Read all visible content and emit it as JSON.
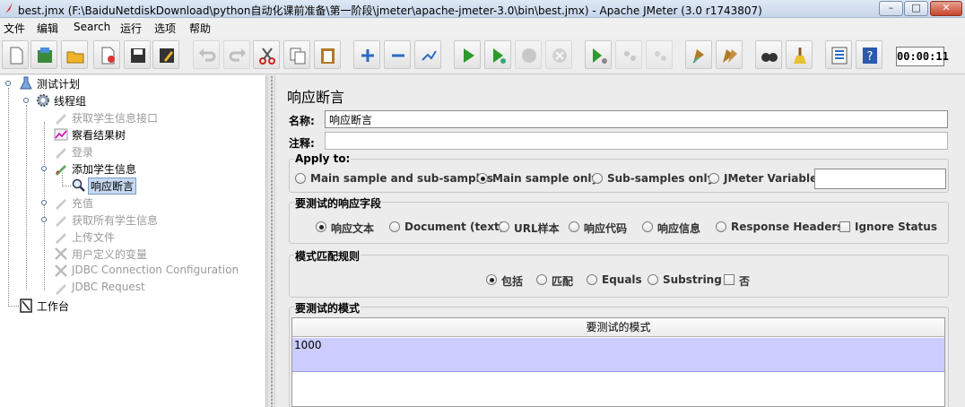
{
  "window": {
    "title": "best.jmx (F:\\BaiduNetdiskDownload\\python自动化课前准备\\第一阶段\\jmeter\\apache-jmeter-3.0\\bin\\best.jmx) - Apache JMeter (3.0 r1743807)"
  },
  "menu": [
    "文件",
    "编辑",
    "Search",
    "运行",
    "选项",
    "帮助"
  ],
  "toolbar": {
    "icons": [
      "new-icon",
      "templates-icon",
      "open-icon",
      "close-icon",
      "save-icon",
      "save-as-icon",
      "undo-icon",
      "redo-icon",
      "cut-icon",
      "copy-icon",
      "paste-icon",
      "expand-icon",
      "collapse-icon",
      "toggle-icon",
      "start-icon",
      "start-no-pause-icon",
      "stop-icon",
      "shutdown-icon",
      "remote-start-icon",
      "remote-stop-icon",
      "remote-shutdown-icon",
      "clear-icon",
      "clear-all-icon",
      "search-icon",
      "reset-search-icon",
      "function-helper-icon",
      "help-icon"
    ],
    "timer": "00:00:11"
  },
  "tree": {
    "nodes": [
      {
        "label": "测试计划",
        "enabled": true
      },
      {
        "label": "线程组",
        "enabled": true
      },
      {
        "label": "获取学生信息接口",
        "enabled": false
      },
      {
        "label": "察看结果树",
        "enabled": true
      },
      {
        "label": "登录",
        "enabled": false
      },
      {
        "label": "添加学生信息",
        "enabled": true
      },
      {
        "label": "响应断言",
        "enabled": true,
        "selected": true
      },
      {
        "label": "充值",
        "enabled": false
      },
      {
        "label": "获取所有学生信息",
        "enabled": false
      },
      {
        "label": "上传文件",
        "enabled": false
      },
      {
        "label": "用户定义的变量",
        "enabled": false
      },
      {
        "label": "JDBC Connection Configuration",
        "enabled": false
      },
      {
        "label": "JDBC Request",
        "enabled": false
      },
      {
        "label": "工作台",
        "enabled": true
      }
    ]
  },
  "panel": {
    "title": "响应断言",
    "name_label": "名称:",
    "name_value": "响应断言",
    "comment_label": "注释:",
    "comment_value": "",
    "apply_to": {
      "title": "Apply to:",
      "options": [
        "Main sample and sub-samples",
        "Main sample only",
        "Sub-samples only",
        "JMeter Variable"
      ],
      "selected": "Main sample only",
      "variable_value": ""
    },
    "response_field": {
      "title": "要测试的响应字段",
      "options": [
        "响应文本",
        "Document (text)",
        "URL样本",
        "响应代码",
        "响应信息",
        "Response Headers"
      ],
      "selected": "响应文本",
      "ignore_status_label": "Ignore Status",
      "ignore_status_checked": false
    },
    "pattern_rules": {
      "title": "模式匹配规则",
      "options": [
        "包括",
        "匹配",
        "Equals",
        "Substring"
      ],
      "selected": "包括",
      "not_label": "否",
      "not_checked": false
    },
    "patterns": {
      "title": "要测试的模式",
      "column_header": "要测试的模式",
      "rows": [
        "1000"
      ]
    }
  }
}
